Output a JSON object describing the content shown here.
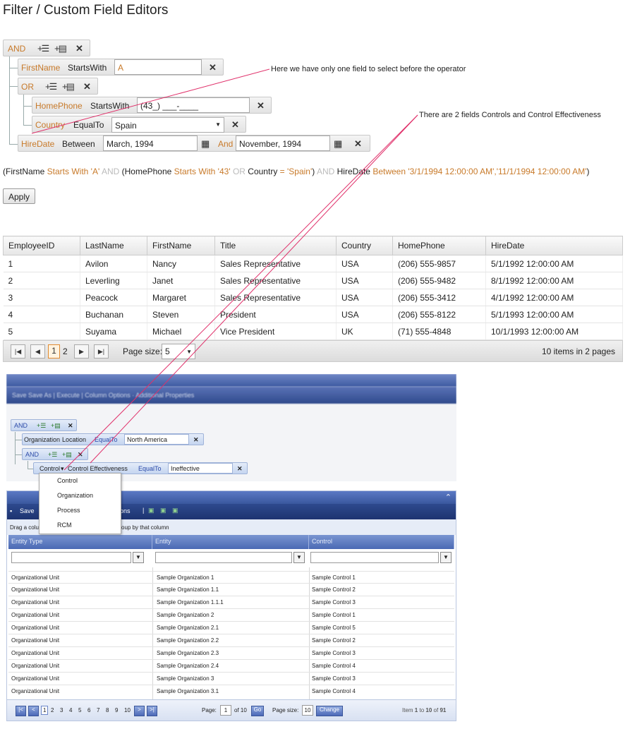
{
  "page_title": "Filter / Custom Field Editors",
  "filter": {
    "root_operator": "AND",
    "row1": {
      "field": "FirstName",
      "op": "StartsWith",
      "value": "A"
    },
    "group_operator": "OR",
    "row2": {
      "field": "HomePhone",
      "op": "StartsWith",
      "value": "(43_) ___-____"
    },
    "row3": {
      "field": "Country",
      "op": "EqualTo",
      "value": "Spain"
    },
    "row4": {
      "field": "HireDate",
      "op": "Between",
      "value1": "March, 1994",
      "and_label": "And",
      "value2": "November, 1994"
    }
  },
  "expression": {
    "p1": "(FirstName ",
    "p2": "Starts With 'A'",
    "p3": " AND ",
    "p4": "(HomePhone ",
    "p5": "Starts With '43'",
    "p6": " OR ",
    "p7": "Country ",
    "p8": "= 'Spain'",
    "p9": ") ",
    "p10": "AND ",
    "p11": "HireDate ",
    "p12": "Between '3/1/1994 12:00:00 AM','11/1/1994 12:00:00 AM'",
    "p13": ")"
  },
  "apply_label": "Apply",
  "grid": {
    "columns": [
      "EmployeeID",
      "LastName",
      "FirstName",
      "Title",
      "Country",
      "HomePhone",
      "HireDate"
    ],
    "rows": [
      [
        "1",
        "Avilon",
        "Nancy",
        "Sales Representative",
        "USA",
        "(206) 555-9857",
        "5/1/1992 12:00:00 AM"
      ],
      [
        "2",
        "Leverling",
        "Janet",
        "Sales Representative",
        "USA",
        "(206) 555-9482",
        "8/1/1992 12:00:00 AM"
      ],
      [
        "3",
        "Peacock",
        "Margaret",
        "Sales Representative",
        "USA",
        "(206) 555-3412",
        "4/1/1992 12:00:00 AM"
      ],
      [
        "4",
        "Buchanan",
        "Steven",
        "President",
        "USA",
        "(206) 555-8122",
        "5/1/1993 12:00:00 AM"
      ],
      [
        "5",
        "Suyama",
        "Michael",
        "Vice President",
        "UK",
        "(71) 555-4848",
        "10/1/1993 12:00:00 AM"
      ]
    ],
    "pager": {
      "page1": "1",
      "page2": "2",
      "page_size_label": "Page size:",
      "page_size": "5",
      "summary": "10 items in 2 pages"
    }
  },
  "annotations": {
    "note1": "Here we have only one field to select before the operator",
    "note2": "There are 2 fields Controls and Control Effectiveness",
    "line_color": "#e0306a"
  },
  "shot1": {
    "toolbar": "Save   Save As  |  Execute  |  Column Options  ·  Additional Properties",
    "and1": "AND",
    "r1_field1": "Organization",
    "r1_field2": "Location",
    "r1_op": "EqualTo",
    "r1_value": "North America",
    "and2": "AND",
    "r2_field1": "Control",
    "r2_field2": "Control Effectiveness",
    "r2_op": "EqualTo",
    "r2_value": "Ineffective",
    "dropdown": [
      "Control",
      "Organization",
      "Process",
      "RCM"
    ]
  },
  "shot2": {
    "save": "Save",
    "ons": "ons",
    "drag_left": "Drag a colu",
    "drag_right": "oup by that column",
    "columns": [
      "Entity Type",
      "Entity",
      "Control"
    ],
    "rows": [
      [
        "Organizational Unit",
        "Sample Organization 1",
        "Sample Control 1"
      ],
      [
        "Organizational Unit",
        "Sample Organization 1.1",
        "Sample Control 2"
      ],
      [
        "Organizational Unit",
        "Sample Organization 1.1.1",
        "Sample Control 3"
      ],
      [
        "Organizational Unit",
        "Sample Organization 2",
        "Sample Control 1"
      ],
      [
        "Organizational Unit",
        "Sample Organization 2.1",
        "Sample Control 5"
      ],
      [
        "Organizational Unit",
        "Sample Organization 2.2",
        "Sample Control 2"
      ],
      [
        "Organizational Unit",
        "Sample Organization 2.3",
        "Sample Control 3"
      ],
      [
        "Organizational Unit",
        "Sample Organization 2.4",
        "Sample Control 4"
      ],
      [
        "Organizational Unit",
        "Sample Organization 3",
        "Sample Control 3"
      ],
      [
        "Organizational Unit",
        "Sample Organization 3.1",
        "Sample Control 4"
      ]
    ],
    "pager": {
      "pages": [
        "1",
        "2",
        "3",
        "4",
        "5",
        "6",
        "7",
        "8",
        "9",
        "10"
      ],
      "page_label": "Page:",
      "page_value": "1",
      "of": "of 10",
      "go": "Go",
      "size_label": "Page size:",
      "size_value": "10",
      "change": "Change",
      "item_label": "Item",
      "item_from": "1",
      "to": "to",
      "item_to": "10",
      "of2": "of",
      "total": "91"
    }
  }
}
